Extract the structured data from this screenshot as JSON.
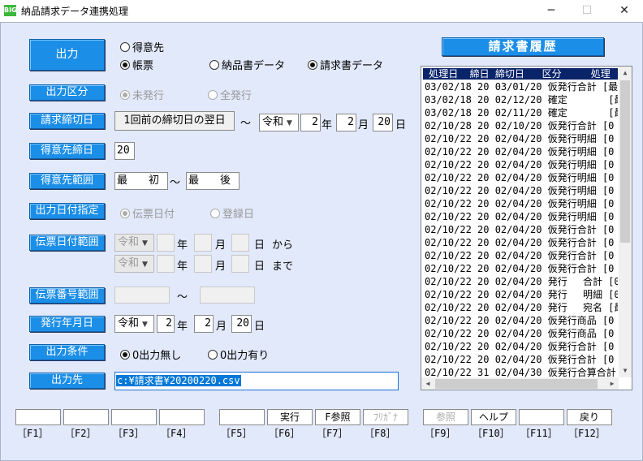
{
  "window": {
    "icon_text": "BIG",
    "title": "納品請求データ連携処理",
    "minimize": "─",
    "maximize": "☐",
    "close": "✕"
  },
  "output": {
    "button": "出力",
    "options": [
      "得意先",
      "帳票",
      "納品書データ",
      "請求書データ"
    ],
    "selected": [
      "帳票",
      "請求書データ"
    ]
  },
  "output_type": {
    "label": "出力区分",
    "options": [
      "未発行",
      "全発行"
    ],
    "selected": "未発行"
  },
  "closing_date": {
    "label": "請求締切日",
    "button": "1回前の締切日の翌日",
    "tilde": "～",
    "era": "令和",
    "year": "2",
    "year_unit": "年",
    "month": "2",
    "month_unit": "月",
    "day": "20",
    "day_unit": "日"
  },
  "customer_closing": {
    "label": "得意先締日",
    "value": "20"
  },
  "customer_range": {
    "label": "得意先範囲",
    "from": "最　　初",
    "tilde": "～",
    "to": "最　　後"
  },
  "output_date_spec": {
    "label": "出力日付指定",
    "options": [
      "伝票日付",
      "登録日"
    ],
    "selected": "伝票日付"
  },
  "slip_date_range": {
    "label": "伝票日付範囲",
    "era": "令和",
    "year_unit": "年",
    "month_unit": "月",
    "day_unit": "日",
    "from_suffix": "から",
    "to_suffix": "まで"
  },
  "slip_no_range": {
    "label": "伝票番号範囲",
    "tilde": "～"
  },
  "issue_date": {
    "label": "発行年月日",
    "era": "令和",
    "year": "2",
    "year_unit": "年",
    "month": "2",
    "month_unit": "月",
    "day": "20",
    "day_unit": "日"
  },
  "output_condition": {
    "label": "出力条件",
    "options": [
      "0出力無し",
      "0出力有り"
    ],
    "selected": "0出力無し"
  },
  "output_dest": {
    "label": "出力先",
    "value": "c:¥請求書¥20200220.csv"
  },
  "history": {
    "title": "請求書履歴",
    "header": " 処理日  締日 締切日   区分     処理",
    "rows": [
      "03/02/18 20 03/01/20 仮発行合計 [最",
      "03/02/18 20 02/12/20 確定       [最",
      "03/02/18 20 02/11/20 確定       [最",
      "02/10/28 20 02/10/20 仮発行合計 [0",
      "02/10/22 20 02/04/20 仮発行明細 [0",
      "02/10/22 20 02/04/20 仮発行明細 [0",
      "02/10/22 20 02/04/20 仮発行明細 [0",
      "02/10/22 20 02/04/20 仮発行明細 [0",
      "02/10/22 20 02/04/20 仮発行明細 [0",
      "02/10/22 20 02/04/20 仮発行明細 [0",
      "02/10/22 20 02/04/20 仮発行明細 [0",
      "02/10/22 20 02/04/20 仮発行合計 [0",
      "02/10/22 20 02/04/20 仮発行合計 [0",
      "02/10/22 20 02/04/20 仮発行合計 [0",
      "02/10/22 20 02/04/20 仮発行合計 [0",
      "02/10/22 20 02/04/20 発行　 合計 [0",
      "02/10/22 20 02/04/20 発行　 明細 [0",
      "02/10/22 20 02/04/20 発行　 宛名 [最",
      "02/10/22 20 02/04/20 仮発行商品 [0",
      "02/10/22 20 02/04/20 仮発行商品 [0",
      "02/10/22 20 02/04/20 仮発行合計 [0",
      "02/10/22 20 02/04/20 仮発行合計 [0",
      "02/10/22 31 02/04/30 仮発行合算合計"
    ]
  },
  "fkeys": [
    {
      "label": "",
      "key": "［F1］"
    },
    {
      "label": "",
      "key": "［F2］"
    },
    {
      "label": "",
      "key": "［F3］"
    },
    {
      "label": "",
      "key": "［F4］"
    },
    {
      "label": "",
      "key": "［F5］"
    },
    {
      "label": "実行",
      "key": "［F6］"
    },
    {
      "label": "F参照",
      "key": "［F7］"
    },
    {
      "label": "ﾌﾘｶﾞﾅ",
      "key": "［F8］"
    },
    {
      "label": "参照",
      "key": "［F9］"
    },
    {
      "label": "ヘルプ",
      "key": "［F10］"
    },
    {
      "label": "",
      "key": "［F11］"
    },
    {
      "label": "戻り",
      "key": "［F12］"
    }
  ]
}
